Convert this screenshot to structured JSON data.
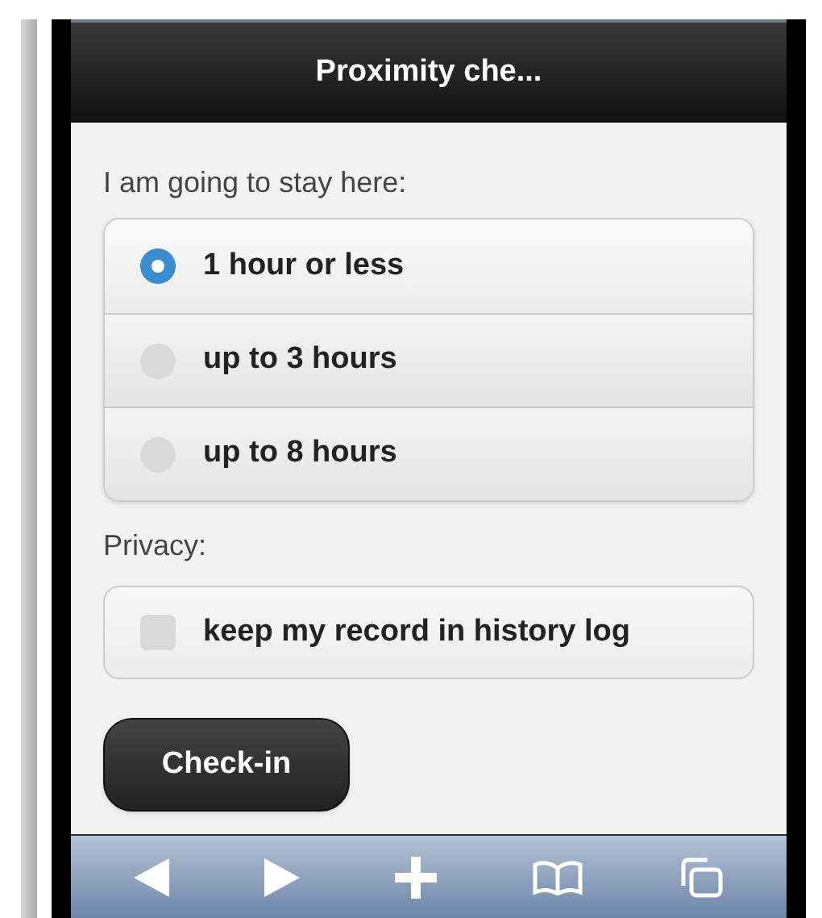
{
  "header": {
    "title": "Proximity che..."
  },
  "stay": {
    "label": "I am going to stay here:",
    "options": [
      {
        "label": "1 hour or less",
        "selected": true
      },
      {
        "label": "up to 3 hours",
        "selected": false
      },
      {
        "label": "up to 8 hours",
        "selected": false
      }
    ]
  },
  "privacy": {
    "label": "Privacy:",
    "checkbox": {
      "label": "keep my record in history log",
      "checked": false
    }
  },
  "button": "Check-in",
  "toolbar": [
    {
      "kind": "back"
    },
    {
      "kind": "forward"
    },
    {
      "kind": "add"
    },
    {
      "kind": "bookmarks"
    },
    {
      "kind": "tabs"
    }
  ]
}
